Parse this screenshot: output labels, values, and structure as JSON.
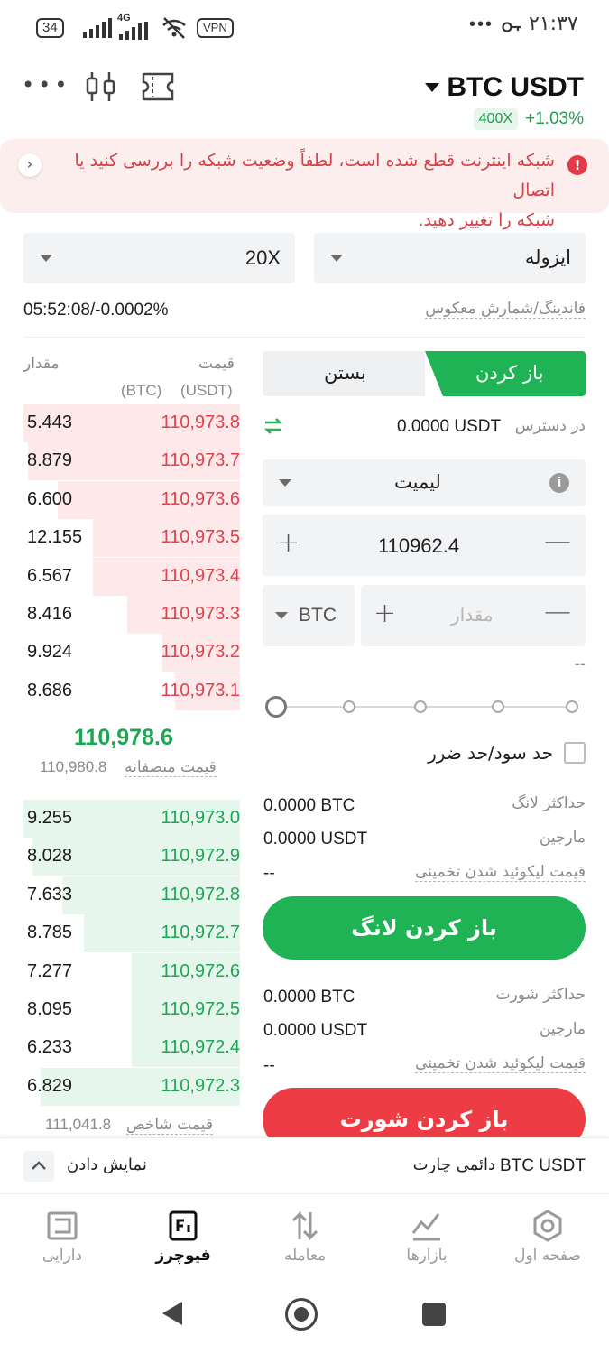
{
  "status": {
    "battery": "34",
    "network": "4G",
    "vpn": "VPN",
    "time": "۲۱:۳۷",
    "more": "•••"
  },
  "header": {
    "pair": "BTC USDT",
    "leverage_badge": "400X",
    "change": "+1.03%"
  },
  "alert": {
    "line1": "شبکه اینترنت قطع شده است، لطفاً وضعیت شبکه را بررسی کنید یا اتصال",
    "line2": "شبکه را تغییر دهید."
  },
  "margin_mode": {
    "value": "ایزوله"
  },
  "leverage": {
    "value": "20X"
  },
  "funding": {
    "label": "فاندینگ/شمارش معکوس",
    "value": "05:52:08/-0.0002%"
  },
  "orderbook": {
    "price_header": "قیمت",
    "price_unit": "(USDT)",
    "qty_header": "مقدار",
    "qty_unit": "(BTC)",
    "asks": [
      {
        "price": "110,973.8",
        "qty": "5.443",
        "depth": 1.0
      },
      {
        "price": "110,973.7",
        "qty": "8.879",
        "depth": 0.98
      },
      {
        "price": "110,973.6",
        "qty": "6.600",
        "depth": 0.84
      },
      {
        "price": "110,973.5",
        "qty": "12.155",
        "depth": 0.68
      },
      {
        "price": "110,973.4",
        "qty": "6.567",
        "depth": 0.68
      },
      {
        "price": "110,973.3",
        "qty": "8.416",
        "depth": 0.52
      },
      {
        "price": "110,973.2",
        "qty": "9.924",
        "depth": 0.36
      },
      {
        "price": "110,973.1",
        "qty": "8.686",
        "depth": 0.3
      }
    ],
    "last_price": "110,978.6",
    "mark_label": "قیمت منصفانه",
    "mark_price": "110,980.8",
    "bids": [
      {
        "price": "110,973.0",
        "qty": "9.255",
        "depth": 1.0
      },
      {
        "price": "110,972.9",
        "qty": "8.028",
        "depth": 0.96
      },
      {
        "price": "110,972.8",
        "qty": "7.633",
        "depth": 0.82
      },
      {
        "price": "110,972.7",
        "qty": "8.785",
        "depth": 0.72
      },
      {
        "price": "110,972.6",
        "qty": "7.277",
        "depth": 0.5
      },
      {
        "price": "110,972.5",
        "qty": "8.095",
        "depth": 0.5
      },
      {
        "price": "110,972.4",
        "qty": "6.233",
        "depth": 0.5
      },
      {
        "price": "110,972.3",
        "qty": "6.829",
        "depth": 0.92
      }
    ],
    "index_label": "قیمت شاخص",
    "index_price": "111,041.8"
  },
  "order_form": {
    "tab_open": "باز کردن",
    "tab_close": "بستن",
    "available_label": "در دسترس",
    "available_value": "0.0000 USDT",
    "order_type": "لیمیت",
    "price_value": "110962.4",
    "amount_placeholder": "مقدار",
    "amount_unit": "BTC",
    "amount_hint": "--",
    "slider_percent": 0,
    "tpsl_label": "حد سود/حد ضرر",
    "long": {
      "max_label": "حداکثر لانگ",
      "max_value": "0.0000 BTC",
      "margin_label": "مارجین",
      "margin_value": "0.0000 USDT",
      "liq_label": "قیمت لیکوئید شدن تخمینی",
      "liq_value": "--",
      "button": "باز کردن لانگ"
    },
    "short": {
      "max_label": "حداکثر شورت",
      "max_value": "0.0000 BTC",
      "margin_label": "مارجین",
      "margin_value": "0.0000 USDT",
      "liq_label": "قیمت لیکوئید شدن تخمینی",
      "liq_value": "--",
      "button": "باز کردن شورت"
    }
  },
  "chart_bar": {
    "pair": "BTC USDT",
    "label": "دائمی چارت",
    "toggle": "نمایش دادن"
  },
  "nav": {
    "home": "صفحه اول",
    "markets": "بازارها",
    "trade": "معامله",
    "futures": "فیوچرز",
    "assets": "دارایی"
  },
  "colors": {
    "green": "#1fb356",
    "red": "#ee3c44",
    "alert_bg": "#fdeeee"
  }
}
